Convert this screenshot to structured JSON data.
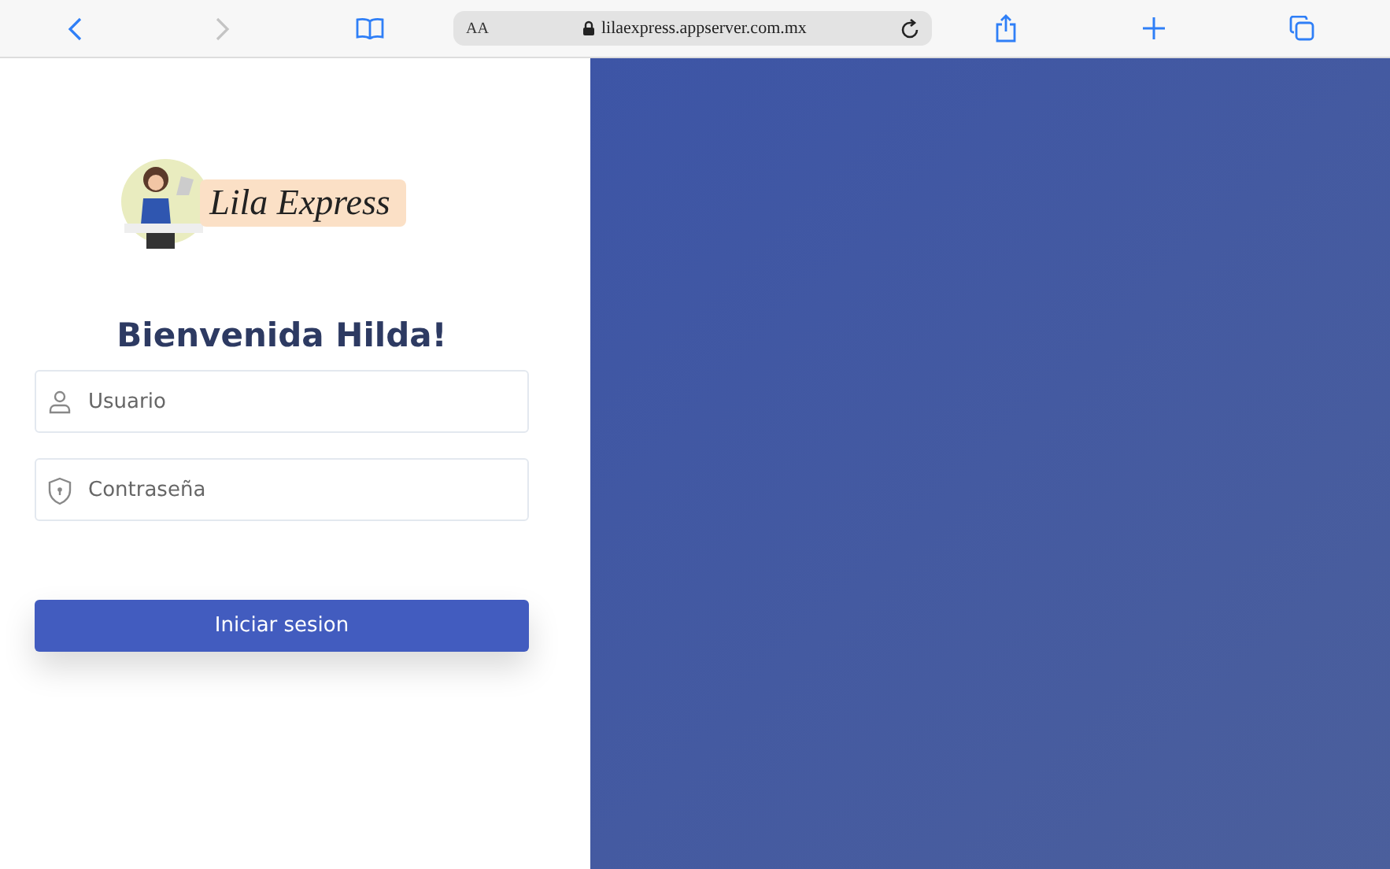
{
  "browser": {
    "nav": [
      {
        "kind": "back",
        "disabled": false
      },
      {
        "kind": "forward",
        "disabled": true
      }
    ],
    "text_size": "AA",
    "url": "lilaexpress.appserver.com.mx"
  },
  "logo": {
    "text": "Lila Express"
  },
  "title": "Bienvenida Hilda!",
  "fields": [
    {
      "kind": "user",
      "placeholder": "Usuario"
    },
    {
      "kind": "password",
      "placeholder": "Contraseña"
    }
  ],
  "submit": "Iniciar sesion"
}
